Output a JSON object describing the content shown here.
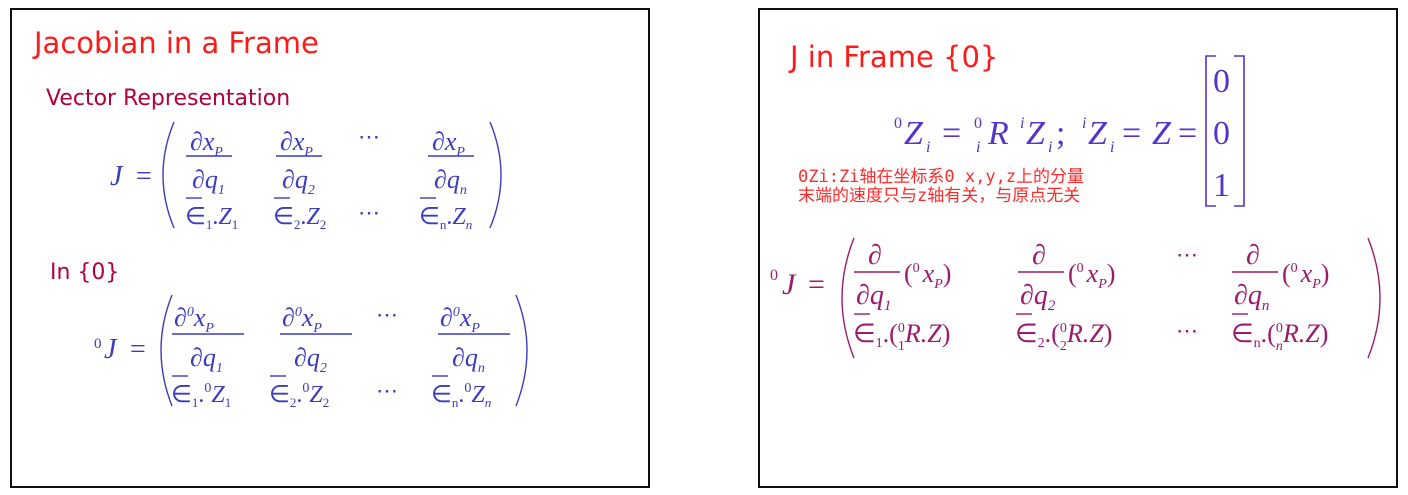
{
  "left_slide": {
    "title": "Jacobian in a Frame",
    "subtitle_vector": "Vector Representation",
    "subtitle_frame": "In {0}",
    "eq1": {
      "lhs": "J",
      "equals": "=",
      "numerator": "∂x",
      "numerator_sub": "P",
      "denominator": "∂q",
      "denom_subs": [
        "1",
        "2",
        "n"
      ],
      "eps_subs": [
        "1",
        "2",
        "n"
      ],
      "z": "Z",
      "ellipsis": "⋯"
    },
    "eq2": {
      "lhs_sup": "0",
      "lhs": "J",
      "equals": "=",
      "numerator": "∂",
      "numerator_sup": "0",
      "numerator_x": "x",
      "numerator_sub": "P",
      "denominator": "∂q",
      "denom_subs": [
        "1",
        "2",
        "n"
      ],
      "eps_subs": [
        "1",
        "2",
        "n"
      ],
      "z_sup": "0",
      "z": "Z",
      "ellipsis": "⋯"
    }
  },
  "right_slide": {
    "title": "J in Frame {0}",
    "zeq": {
      "sup0": "0",
      "Z": "Z",
      "sub_i": "i",
      "equals": "=",
      "R": "R",
      "semicolon": ";",
      "sup_i": "i",
      "vector": [
        "0",
        "0",
        "1"
      ]
    },
    "note_lines": [
      "0Zi:Zi轴在坐标系0 x,y,z上的分量",
      "末端的速度只与z轴有关，与原点无关"
    ],
    "eq": {
      "lhs_sup": "0",
      "lhs": "J",
      "equals": "=",
      "partial": "∂",
      "denominator": "∂q",
      "denom_subs": [
        "1",
        "2",
        "n"
      ],
      "arg_sup": "0",
      "arg_x": "x",
      "arg_sub": "P",
      "eps_subs": [
        "1",
        "2",
        "n"
      ],
      "R": "R",
      "Z": ".Z",
      "ellipsis": "⋯"
    }
  },
  "colors": {
    "title": "#ff1a1a",
    "subtitle": "#b3003b",
    "math_blue": "#3b3bc0",
    "math_violet": "#5533cc",
    "math_magenta": "#9c1a6e",
    "note": "#ff2a2a"
  }
}
